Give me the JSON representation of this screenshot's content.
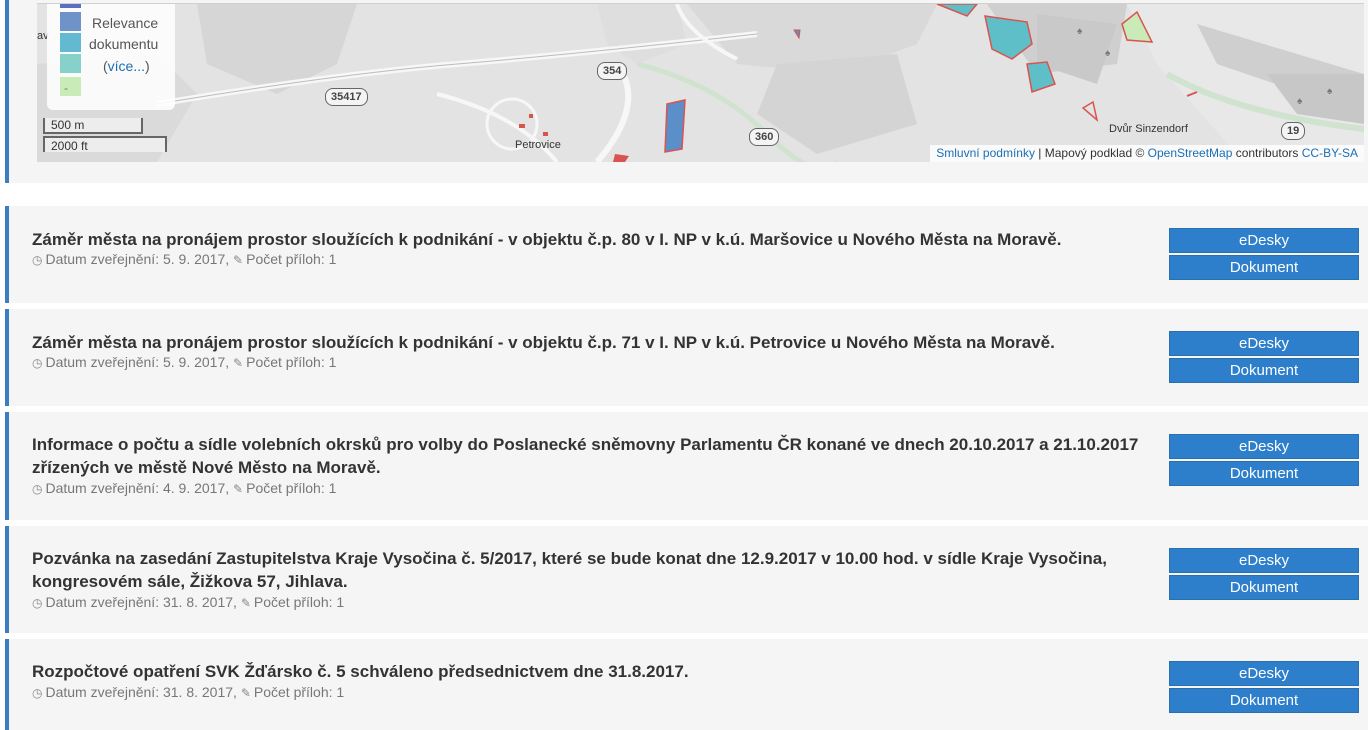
{
  "map": {
    "legend": {
      "label_line1": "Relevance",
      "label_line2": "dokumentu",
      "more_paren_open": "(",
      "more_link": "více...",
      "more_paren_close": ")",
      "dash": "-",
      "swatch_colors": [
        "#6f93c9",
        "#62b9d0",
        "#86d1c9",
        "#c8ebb8"
      ]
    },
    "scale": {
      "metric": "500 m",
      "imperial": "2000 ft"
    },
    "labels": {
      "town": "Petrovice",
      "farm": "Dvůr Sinzendorf",
      "road_35417": "35417",
      "road_354": "354",
      "road_360": "360",
      "road_19": "19",
      "edge_text": "av"
    },
    "attribution": {
      "terms_link": "Smluvní podmínky",
      "separator": " | Mapový podklad © ",
      "osm_link": "OpenStreetMap",
      "contributors": " contributors ",
      "license_link": "CC-BY-SA"
    }
  },
  "items": [
    {
      "title": "Záměr města na pronájem prostor sloužících k podnikání - v objektu č.p. 80 v I. NP v k.ú. Maršovice u Nového Města na Moravě.",
      "date_label": "Datum zveřejnění: 5. 9. 2017,",
      "attachments_label": "Počet příloh: 1",
      "btn_edesky": "eDesky",
      "btn_dokument": "Dokument"
    },
    {
      "title": "Záměr města na pronájem prostor sloužících k podnikání - v objektu č.p. 71 v I. NP v k.ú. Petrovice u Nového Města na Moravě.",
      "date_label": "Datum zveřejnění: 5. 9. 2017,",
      "attachments_label": "Počet příloh: 1",
      "btn_edesky": "eDesky",
      "btn_dokument": "Dokument"
    },
    {
      "title": "Informace o počtu a sídle volebních okrsků pro volby do Poslanecké sněmovny Parlamentu ČR konané ve dnech 20.10.2017 a 21.10.2017 zřízených ve městě Nové Město na Moravě.",
      "date_label": "Datum zveřejnění: 4. 9. 2017,",
      "attachments_label": "Počet příloh: 1",
      "btn_edesky": "eDesky",
      "btn_dokument": "Dokument"
    },
    {
      "title": "Pozvánka na zasedání Zastupitelstva Kraje Vysočina č. 5/2017, které se bude konat dne 12.9.2017 v 10.00 hod. v sídle Kraje Vysočina, kongresovém sále, Žižkova 57, Jihlava.",
      "date_label": "Datum zveřejnění: 31. 8. 2017,",
      "attachments_label": "Počet příloh: 1",
      "btn_edesky": "eDesky",
      "btn_dokument": "Dokument"
    },
    {
      "title": "Rozpočtové opatření SVK Žďársko č. 5 schváleno předsednictvem dne 31.8.2017.",
      "date_label": "Datum zveřejnění: 31. 8. 2017,",
      "attachments_label": "Počet příloh: 1",
      "btn_edesky": "eDesky",
      "btn_dokument": "Dokument"
    }
  ],
  "colors": {
    "accent": "#3a7dc0",
    "button": "#2d7fcb",
    "card_bg": "#f5f5f5"
  },
  "icons": {
    "date": "clock-icon",
    "attachments": "paperclip-icon"
  }
}
